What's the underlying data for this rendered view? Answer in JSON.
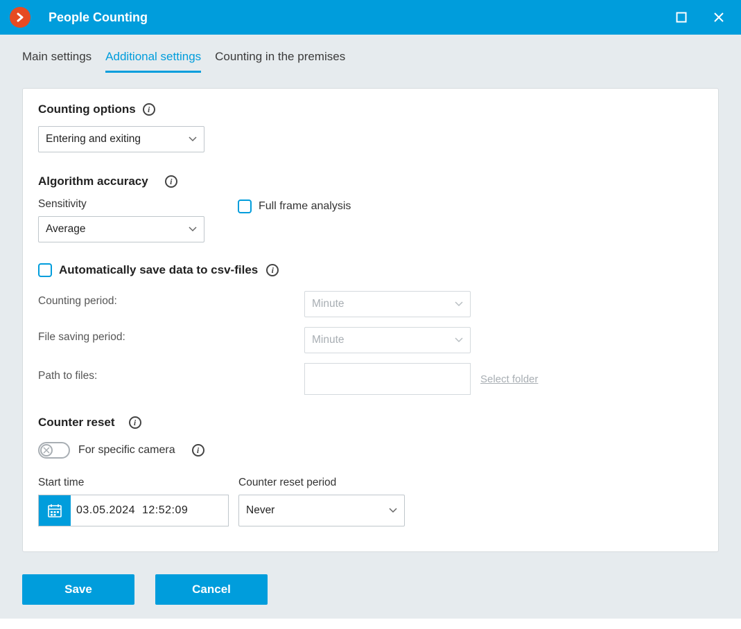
{
  "titlebar": {
    "title": "People Counting"
  },
  "tabs": {
    "main": "Main settings",
    "additional": "Additional settings",
    "counting_premises": "Counting in the premises"
  },
  "counting_options": {
    "heading": "Counting options",
    "value": "Entering and exiting"
  },
  "algorithm_accuracy": {
    "heading": "Algorithm accuracy",
    "sensitivity_label": "Sensitivity",
    "sensitivity_value": "Average",
    "full_frame_label": "Full frame analysis"
  },
  "csv": {
    "checkbox_label": "Automatically save data to csv-files",
    "counting_period_label": "Counting period:",
    "counting_period_value": "Minute",
    "file_saving_label": "File saving period:",
    "file_saving_value": "Minute",
    "path_label": "Path to files:",
    "select_folder": "Select folder"
  },
  "counter_reset": {
    "heading": "Counter reset",
    "for_specific_label": "For specific camera",
    "start_time_label": "Start time",
    "start_time_value": "03.05.2024  12:52:09",
    "period_label": "Counter reset period",
    "period_value": "Never"
  },
  "footer": {
    "save": "Save",
    "cancel": "Cancel"
  }
}
